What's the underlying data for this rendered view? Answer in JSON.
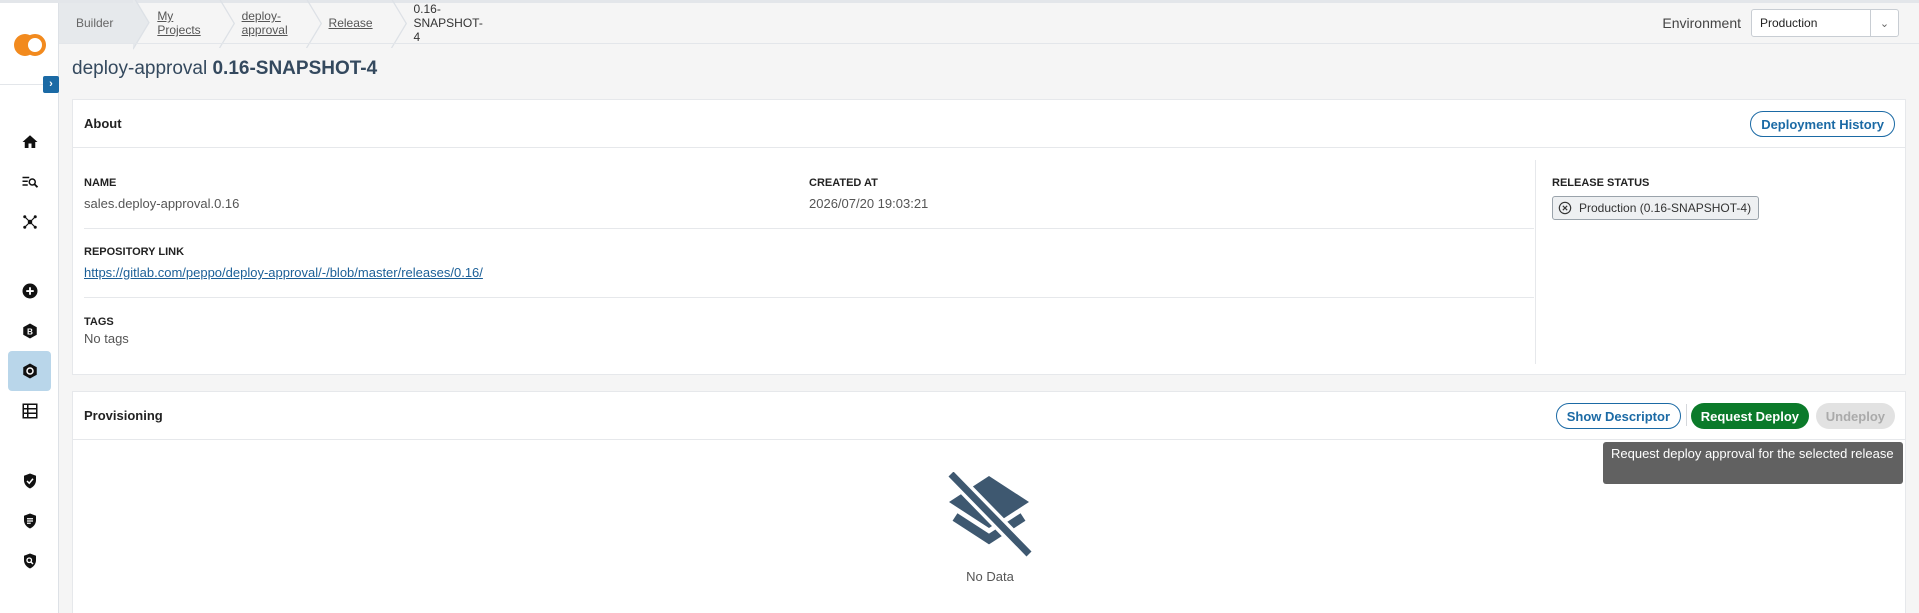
{
  "breadcrumb": {
    "items": [
      {
        "label": "Builder",
        "link": false
      },
      {
        "label": "My Projects",
        "link": true
      },
      {
        "label": "deploy-approval",
        "link": true
      },
      {
        "label": "Release",
        "link": true
      },
      {
        "label": "0.16-SNAPSHOT-4",
        "link": false
      }
    ]
  },
  "environment": {
    "label": "Environment",
    "selected": "Production"
  },
  "page": {
    "title_prefix": "deploy-approval",
    "title_version": "0.16-SNAPSHOT-4"
  },
  "about": {
    "title": "About",
    "history_button": "Deployment History",
    "name_label": "NAME",
    "name_value": "sales.deploy-approval.0.16",
    "created_label": "CREATED AT",
    "created_value": "2026/07/20 19:03:21",
    "repo_label": "REPOSITORY LINK",
    "repo_value": "https://gitlab.com/peppo/deploy-approval/-/blob/master/releases/0.16/",
    "tags_label": "TAGS",
    "tags_value": "No tags",
    "status_label": "RELEASE STATUS",
    "status_chip": "Production (0.16-SNAPSHOT-4)"
  },
  "provisioning": {
    "title": "Provisioning",
    "show_descriptor": "Show Descriptor",
    "request_deploy": "Request Deploy",
    "undeploy": "Undeploy",
    "tooltip": "Request deploy approval for the selected release",
    "empty_text": "No Data"
  },
  "sidebar": {
    "icons": [
      "home-icon",
      "search-list-icon",
      "graph-icon",
      "add-circle-icon",
      "b-badge-icon",
      "hexagon-icon",
      "table-icon",
      "shield-check-icon",
      "shield-list-icon",
      "shield-search-icon"
    ],
    "active": "hexagon-icon"
  },
  "colors": {
    "accent": "#1b6aa5",
    "success": "#0b7a2a",
    "brand": "#f28a1e",
    "active_nav": "#b9d6ea"
  }
}
